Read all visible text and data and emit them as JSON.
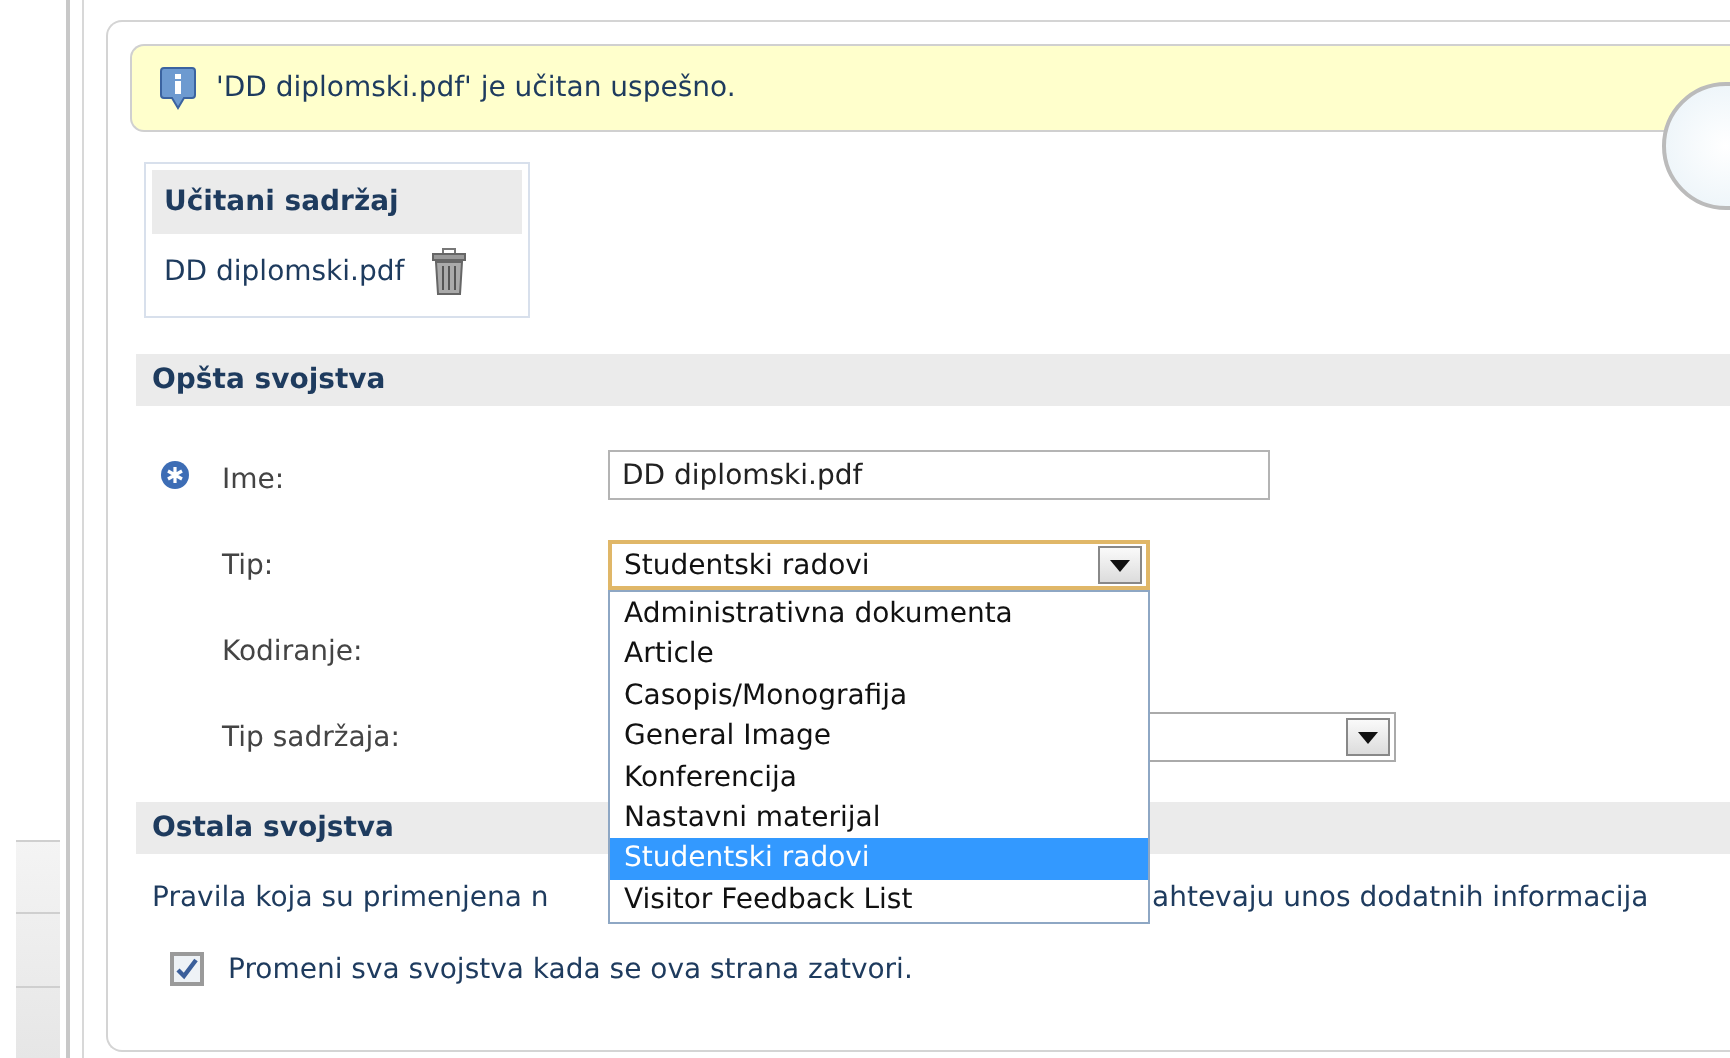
{
  "info_message": "'DD diplomski.pdf' je učitan uspešno.",
  "uploaded": {
    "title": "Učitani sadržaj",
    "file": "DD diplomski.pdf"
  },
  "general": {
    "title": "Opšta svojstva",
    "fields": [
      {
        "label": "Ime:",
        "required": true,
        "kind": "text",
        "value": "DD diplomski.pdf"
      },
      {
        "label": "Tip:",
        "required": false,
        "kind": "select",
        "value": "Studentski radovi",
        "expanded": true,
        "options": [
          {
            "label": "Administrativna dokumenta",
            "selected": false
          },
          {
            "label": "Article",
            "selected": false
          },
          {
            "label": "Casopis/Monografija",
            "selected": false
          },
          {
            "label": "General Image",
            "selected": false
          },
          {
            "label": "Konferencija",
            "selected": false
          },
          {
            "label": "Nastavni materijal",
            "selected": false
          },
          {
            "label": "Studentski radovi",
            "selected": true
          },
          {
            "label": "Visitor Feedback List",
            "selected": false
          }
        ]
      },
      {
        "label": "Kodiranje:",
        "required": false,
        "kind": "covered"
      },
      {
        "label": "Tip sadržaja:",
        "required": false,
        "kind": "select",
        "expanded": false
      }
    ]
  },
  "other": {
    "title": "Ostala svojstva",
    "note_start": "Pravila koja su primenjena n",
    "note_end": "ahtevaju unos dodatnih informacija",
    "checkbox": {
      "label": "Promeni sva svojstva kada se ova strana zatvori.",
      "checked": true
    }
  }
}
